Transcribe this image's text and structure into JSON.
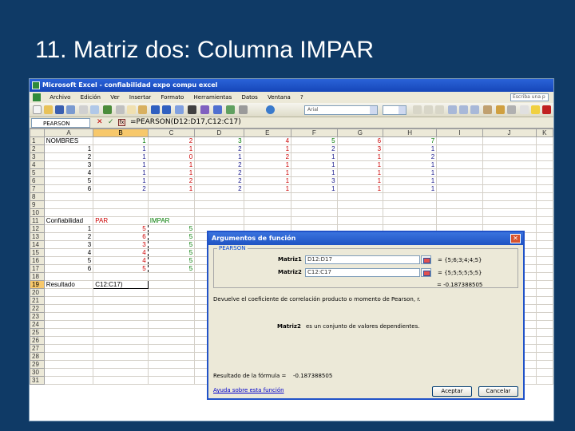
{
  "slide": {
    "title": "11. Matriz dos: Columna IMPAR"
  },
  "excel": {
    "title": "Microsoft Excel - confiabilidad expo compu excel",
    "menu": [
      "Archivo",
      "Edición",
      "Ver",
      "Insertar",
      "Formato",
      "Herramientas",
      "Datos",
      "Ventana",
      "?"
    ],
    "help_placeholder": "Escriba una p",
    "font_name": "Arial",
    "namebox": "PEARSON",
    "formula": "=PEARSON(D12:D17,C12:C17)",
    "columns": [
      "A",
      "B",
      "C",
      "D",
      "E",
      "F",
      "G",
      "H",
      "I",
      "J",
      "K"
    ],
    "rows": [
      {
        "n": "1",
        "cells": [
          "NOMBRES",
          "1",
          "2",
          "3",
          "4",
          "5",
          "6",
          "7",
          "",
          "",
          ""
        ]
      },
      {
        "n": "2",
        "cells": [
          "1",
          "1",
          "1",
          "2",
          "1",
          "2",
          "3",
          "1",
          "",
          "",
          ""
        ]
      },
      {
        "n": "3",
        "cells": [
          "2",
          "1",
          "0",
          "1",
          "2",
          "1",
          "1",
          "2",
          "",
          "",
          ""
        ]
      },
      {
        "n": "4",
        "cells": [
          "3",
          "1",
          "1",
          "2",
          "1",
          "1",
          "1",
          "1",
          "",
          "",
          ""
        ]
      },
      {
        "n": "5",
        "cells": [
          "4",
          "1",
          "1",
          "2",
          "1",
          "1",
          "1",
          "1",
          "",
          "",
          ""
        ]
      },
      {
        "n": "6",
        "cells": [
          "5",
          "1",
          "2",
          "2",
          "1",
          "3",
          "1",
          "1",
          "",
          "",
          ""
        ]
      },
      {
        "n": "7",
        "cells": [
          "6",
          "2",
          "1",
          "2",
          "1",
          "1",
          "1",
          "1",
          "",
          "",
          ""
        ]
      },
      {
        "n": "8",
        "cells": [
          "",
          "",
          "",
          "",
          "",
          "",
          "",
          "",
          "",
          "",
          ""
        ]
      },
      {
        "n": "9",
        "cells": [
          "",
          "",
          "",
          "",
          "",
          "",
          "",
          "",
          "",
          "",
          ""
        ]
      },
      {
        "n": "10",
        "cells": [
          "",
          "",
          "",
          "",
          "",
          "",
          "",
          "",
          "",
          "",
          ""
        ]
      },
      {
        "n": "11",
        "cells": [
          "Confiabilidad",
          "PAR",
          "IMPAR",
          "",
          "",
          "",
          "",
          "",
          "",
          "",
          ""
        ]
      },
      {
        "n": "12",
        "cells": [
          "1",
          "5",
          "5",
          "",
          "",
          "",
          "",
          "",
          "",
          "",
          ""
        ]
      },
      {
        "n": "13",
        "cells": [
          "2",
          "6",
          "5",
          "",
          "",
          "",
          "",
          "",
          "",
          "",
          ""
        ]
      },
      {
        "n": "14",
        "cells": [
          "3",
          "3",
          "5",
          "",
          "",
          "",
          "",
          "",
          "",
          "",
          ""
        ]
      },
      {
        "n": "15",
        "cells": [
          "4",
          "4",
          "5",
          "",
          "",
          "",
          "",
          "",
          "",
          "",
          ""
        ]
      },
      {
        "n": "16",
        "cells": [
          "5",
          "4",
          "5",
          "",
          "",
          "",
          "",
          "",
          "",
          "",
          ""
        ]
      },
      {
        "n": "17",
        "cells": [
          "6",
          "5",
          "5",
          "",
          "",
          "",
          "",
          "",
          "",
          "",
          ""
        ]
      },
      {
        "n": "18",
        "cells": [
          "",
          "",
          "",
          "",
          "",
          "",
          "",
          "",
          "",
          "",
          ""
        ]
      },
      {
        "n": "19",
        "cells": [
          "Resultado",
          "C12:C17)",
          "",
          "",
          "",
          "",
          "",
          "",
          "",
          "",
          ""
        ]
      },
      {
        "n": "20",
        "cells": [
          "",
          "",
          "",
          "",
          "",
          "",
          "",
          "",
          "",
          "",
          ""
        ]
      },
      {
        "n": "21",
        "cells": [
          "",
          "",
          "",
          "",
          "",
          "",
          "",
          "",
          "",
          "",
          ""
        ]
      },
      {
        "n": "22",
        "cells": [
          "",
          "",
          "",
          "",
          "",
          "",
          "",
          "",
          "",
          "",
          ""
        ]
      },
      {
        "n": "23",
        "cells": [
          "",
          "",
          "",
          "",
          "",
          "",
          "",
          "",
          "",
          "",
          ""
        ]
      },
      {
        "n": "24",
        "cells": [
          "",
          "",
          "",
          "",
          "",
          "",
          "",
          "",
          "",
          "",
          ""
        ]
      },
      {
        "n": "25",
        "cells": [
          "",
          "",
          "",
          "",
          "",
          "",
          "",
          "",
          "",
          "",
          ""
        ]
      },
      {
        "n": "26",
        "cells": [
          "",
          "",
          "",
          "",
          "",
          "",
          "",
          "",
          "",
          "",
          ""
        ]
      },
      {
        "n": "27",
        "cells": [
          "",
          "",
          "",
          "",
          "",
          "",
          "",
          "",
          "",
          "",
          ""
        ]
      },
      {
        "n": "28",
        "cells": [
          "",
          "",
          "",
          "",
          "",
          "",
          "",
          "",
          "",
          "",
          ""
        ]
      },
      {
        "n": "29",
        "cells": [
          "",
          "",
          "",
          "",
          "",
          "",
          "",
          "",
          "",
          "",
          ""
        ]
      },
      {
        "n": "30",
        "cells": [
          "",
          "",
          "",
          "",
          "",
          "",
          "",
          "",
          "",
          "",
          ""
        ]
      },
      {
        "n": "31",
        "cells": [
          "",
          "",
          "",
          "",
          "",
          "",
          "",
          "",
          "",
          "",
          ""
        ]
      }
    ]
  },
  "dialog": {
    "title": "Argumentos de función",
    "function_name": "PEARSON",
    "arg1_label": "Matriz1",
    "arg1_value": "D12:D17",
    "arg1_result": "= {5;6;3;4;4;5}",
    "arg2_label": "Matriz2",
    "arg2_value": "C12:C17",
    "arg2_result": "= {5;5;5;5;5;5}",
    "result_preview": "= -0.187388505",
    "description": "Devuelve el coeficiente de correlación producto o momento de Pearson, r.",
    "arg_help_label": "Matriz2",
    "arg_help_text": "es un conjunto de valores dependientes.",
    "formula_result_label": "Resultado de la fórmula =",
    "formula_result_value": "-0.187388505",
    "help_link": "Ayuda sobre esta función",
    "ok_label": "Aceptar",
    "cancel_label": "Cancelar"
  }
}
